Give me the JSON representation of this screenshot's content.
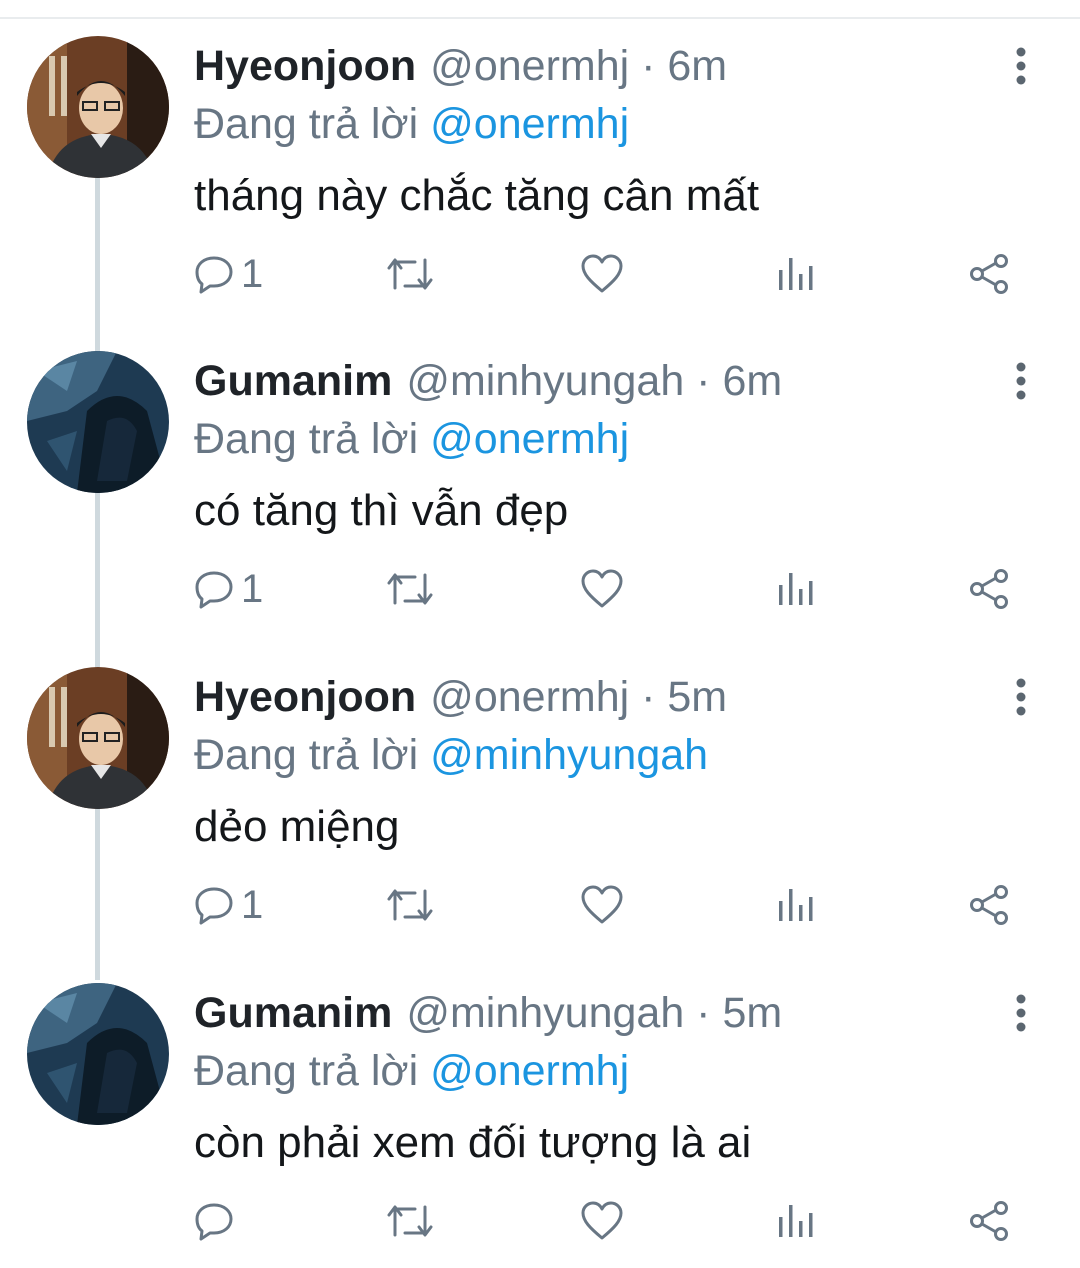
{
  "replying_label": "Đang trả lời",
  "accent": "#1b95e0",
  "tweets": [
    {
      "avatar": "avatar-hyeonjoon",
      "name": "Hyeonjoon",
      "handle_time": "@onermhj · 6m",
      "reply_to": "@onermhj",
      "text": "tháng này chắc tăng cân mất",
      "reply_count": "1"
    },
    {
      "avatar": "avatar-gumanim",
      "name": "Gumanim",
      "handle_time": "@minhyungah · 6m",
      "reply_to": "@onermhj",
      "text": "có tăng thì vẫn đẹp",
      "reply_count": "1"
    },
    {
      "avatar": "avatar-hyeonjoon",
      "name": "Hyeonjoon",
      "handle_time": "@onermhj · 5m",
      "reply_to": "@minhyungah",
      "text": "dẻo miệng",
      "reply_count": "1"
    },
    {
      "avatar": "avatar-gumanim",
      "name": "Gumanim",
      "handle_time": "@minhyungah · 5m",
      "reply_to": "@onermhj",
      "text": "còn phải xem đối tượng là ai",
      "reply_count": ""
    }
  ],
  "icons": {
    "reply": "reply-icon",
    "retweet": "retweet-icon",
    "like": "heart-icon",
    "analytics": "analytics-icon",
    "share": "share-icon",
    "more": "more-vertical-icon"
  }
}
